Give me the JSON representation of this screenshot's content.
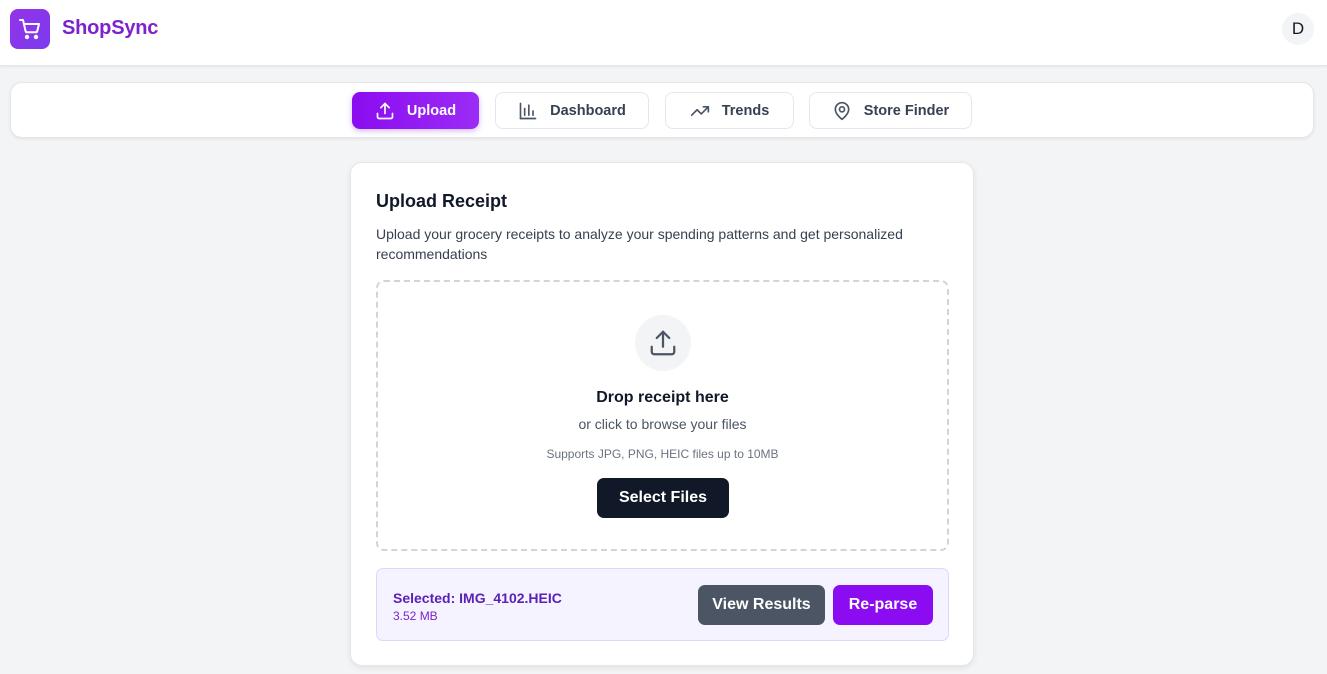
{
  "app": {
    "brand": "ShopSync",
    "user_initial": "D",
    "accent_color": "#8b0cf0"
  },
  "nav": {
    "tabs": [
      {
        "label": "Upload",
        "icon": "upload-icon",
        "active": true
      },
      {
        "label": "Dashboard",
        "icon": "bar-chart-icon",
        "active": false
      },
      {
        "label": "Trends",
        "icon": "trending-up-icon",
        "active": false
      },
      {
        "label": "Store Finder",
        "icon": "map-pin-icon",
        "active": false
      }
    ]
  },
  "upload": {
    "title": "Upload Receipt",
    "description": "Upload your grocery receipts to analyze your spending patterns and get personalized recommendations",
    "drop_title": "Drop receipt here",
    "drop_subtitle": "or click to browse your files",
    "drop_hint": "Supports JPG, PNG, HEIC files up to 10MB",
    "select_button": "Select Files"
  },
  "selection": {
    "label": "Selected: IMG_4102.HEIC",
    "size": "3.52 MB",
    "view_button": "View Results",
    "reparse_button": "Re-parse"
  }
}
